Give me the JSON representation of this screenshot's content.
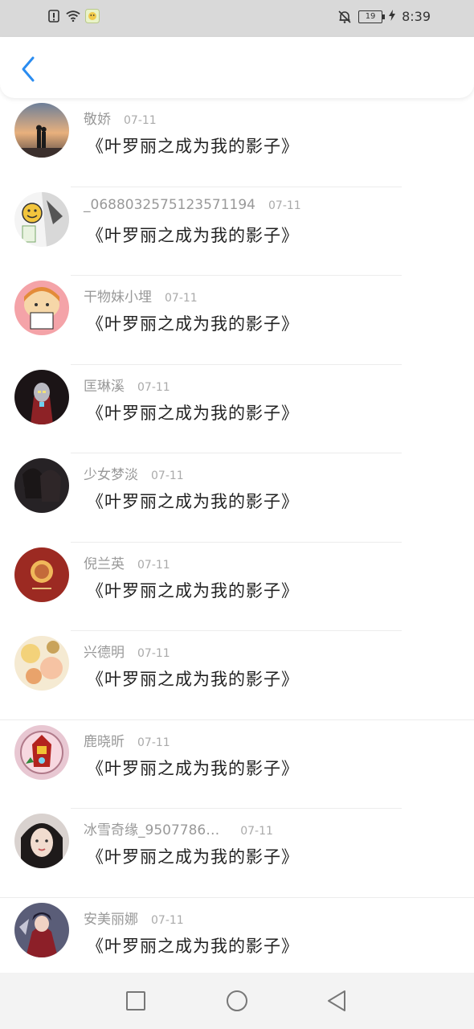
{
  "status_bar": {
    "time": "8:39",
    "battery": "19",
    "icons": [
      "alert-icon",
      "wifi-icon",
      "app-notification-icon",
      "mute-bell-icon",
      "battery-icon",
      "charging-icon"
    ]
  },
  "header": {
    "back_icon": "chevron-left-icon",
    "accent": "#2a8cf0"
  },
  "comments": [
    {
      "name": "敬娇",
      "date": "07-11",
      "message": "《叶罗丽之成为我的影子》",
      "avatar": "sunset-silhouette"
    },
    {
      "name": "_0688032575123571194",
      "date": "07-11",
      "message": "《叶罗丽之成为我的影子》",
      "avatar": "manga-emoji"
    },
    {
      "name": "干物妹小埋",
      "date": "07-11",
      "message": "《叶罗丽之成为我的影子》",
      "avatar": "anime-girl-pink"
    },
    {
      "name": "匡琳溪",
      "date": "07-11",
      "message": "《叶罗丽之成为我的影子》",
      "avatar": "hero-red-dark"
    },
    {
      "name": "少女梦淡",
      "date": "07-11",
      "message": "《叶罗丽之成为我的影子》",
      "avatar": "two-girls-dark"
    },
    {
      "name": "倪兰英",
      "date": "07-11",
      "message": "《叶罗丽之成为我的影子》",
      "avatar": "red-badge"
    },
    {
      "name": "兴德明",
      "date": "07-11",
      "message": "《叶罗丽之成为我的影子》",
      "avatar": "flowers-cream"
    },
    {
      "name": "鹿晓昕",
      "date": "07-11",
      "message": "《叶罗丽之成为我的影子》",
      "avatar": "ironman-circle"
    },
    {
      "name": "冰雪奇缘_9507786…",
      "date": "07-11",
      "message": "《叶罗丽之成为我的影子》",
      "avatar": "woman-portrait"
    },
    {
      "name": "安美丽娜",
      "date": "07-11",
      "message": "《叶罗丽之成为我的影子》",
      "avatar": "anime-red-dress"
    }
  ],
  "nav_bar": {
    "icons": [
      "recent-apps-square-icon",
      "home-circle-icon",
      "back-triangle-icon"
    ]
  }
}
